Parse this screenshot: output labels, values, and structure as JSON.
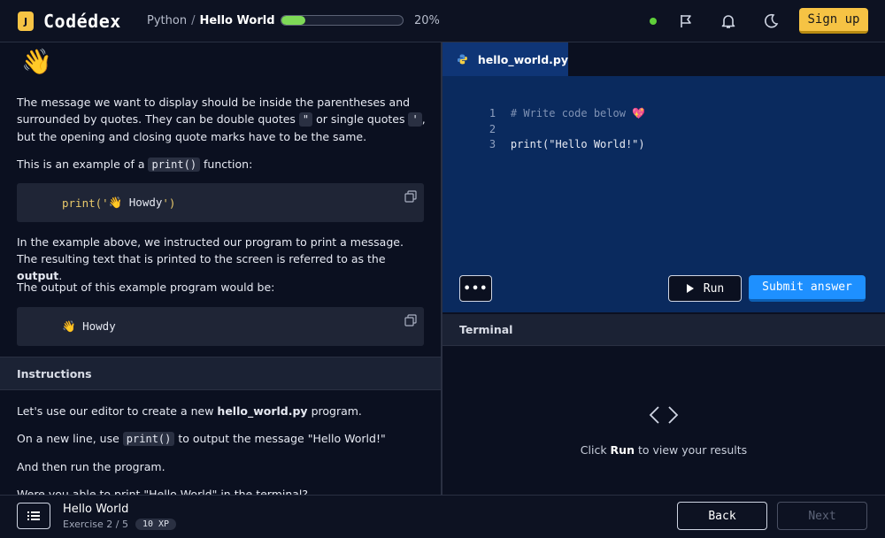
{
  "header": {
    "logo_text": "Codédex",
    "logo_mark": "J",
    "breadcrumb_course": "Python",
    "breadcrumb_sep": "/",
    "breadcrumb_lesson": "Hello World",
    "progress_label": "20%",
    "progress_value": 0.2,
    "signup_label": "Sign up",
    "icons": [
      "status-dot",
      "flag-icon",
      "bell-icon",
      "moon-icon"
    ]
  },
  "lesson": {
    "wave": "👋",
    "p1_a": "The message we want to display should be inside the parentheses and surrounded by quotes. They can be double quotes ",
    "p1_dq": "\"",
    "p1_b": " or single quotes ",
    "p1_sq": "'",
    "p1_c": ", but the opening and closing quote marks have to be the same.",
    "p2_a": "This is an example of a ",
    "p2_code": "print()",
    "p2_b": " function:",
    "code1_a": "print('",
    "code1_b": "👋 Howdy",
    "code1_c": "')",
    "p3_a": "In the example above, we instructed our program to print a message. The resulting text that is printed to the screen is referred to as the ",
    "p3_bold": "output",
    "p3_c": ".",
    "p4": "The output of this example program would be:",
    "code2": "👋 Howdy",
    "instructions_title": "Instructions",
    "i1_a": "Let's use our editor to create a new ",
    "i1_bold": "hello_world.py",
    "i1_c": " program.",
    "i2_a": "On a new line, use ",
    "i2_code": "print()",
    "i2_c": " to output the message \"Hello World!\"",
    "i3": "And then run the program.",
    "i4": "Were you able to print \"Hello World\" in the terminal?"
  },
  "editor": {
    "tab_name": "hello_world.py",
    "lines": [
      {
        "num": "1",
        "text": "# Write code below 💖"
      },
      {
        "num": "2",
        "text": ""
      },
      {
        "num": "3",
        "text": "print(\"Hello World!\")"
      }
    ],
    "more_label": "•••",
    "run_label": "Run",
    "submit_label": "Submit answer"
  },
  "terminal": {
    "title": "Terminal",
    "msg_a": "Click ",
    "msg_bold": "Run",
    "msg_c": " to view your results"
  },
  "footer": {
    "lesson_title": "Hello World",
    "exercise_label": "Exercise 2 / 5",
    "xp_label": "10 XP",
    "back_label": "Back",
    "next_label": "Next"
  },
  "colors": {
    "accent_yellow": "#f6c344",
    "accent_blue": "#1e90ff",
    "progress_green": "#7ed957",
    "editor_bg": "#0a2a5e"
  }
}
